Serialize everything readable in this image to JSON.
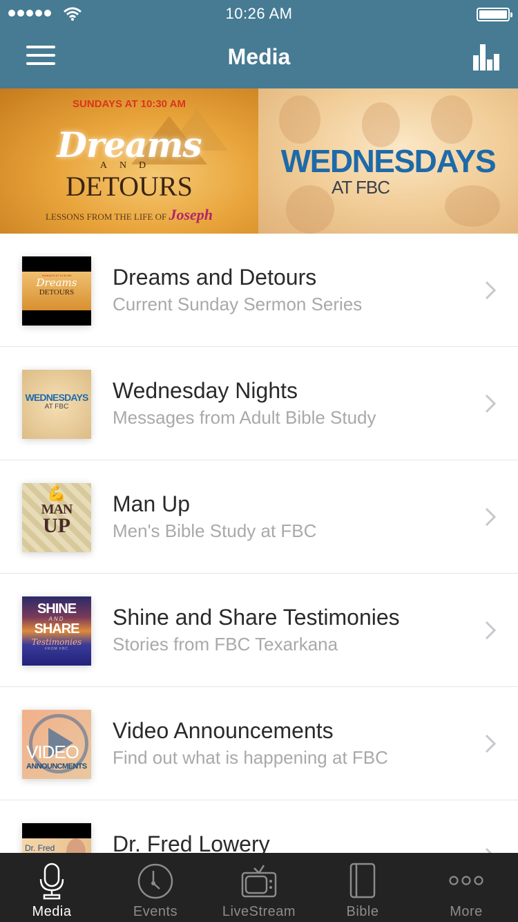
{
  "status_bar": {
    "time": "10:26 AM",
    "signal_bars": 5,
    "battery_percent": 100
  },
  "nav": {
    "title": "Media",
    "left_icon": "hamburger-menu-icon",
    "right_icon": "bar-chart-icon"
  },
  "banners": [
    {
      "name": "Dreams and Detours",
      "line1": "SUNDAYS AT 10:30 AM",
      "line2": "Dreams",
      "line3": "AND",
      "line4": "DETOURS",
      "line5": "LESSONS FROM THE LIFE OF",
      "line6": "Joseph"
    },
    {
      "name": "Wednesdays at FBC",
      "line1": "WEDNESDAYS",
      "line2": "AT FBC"
    }
  ],
  "list": {
    "items": [
      {
        "title": "Dreams and Detours",
        "subtitle": "Current Sunday Sermon Series",
        "thumb": {
          "t1": "SUNDAYS AT 10:30 AM",
          "t2": "Dreams",
          "t3": "DETOURS"
        }
      },
      {
        "title": "Wednesday Nights",
        "subtitle": "Messages from Adult Bible Study",
        "thumb": {
          "t1": "WEDNESDAYS",
          "t2": "AT FBC"
        }
      },
      {
        "title": "Man Up",
        "subtitle": "Men's Bible Study at FBC",
        "thumb": {
          "t0": "💪",
          "t1": "MAN",
          "t2": "UP"
        }
      },
      {
        "title": "Shine and Share Testimonies",
        "subtitle": "Stories from FBC Texarkana",
        "thumb": {
          "t1": "SHINE",
          "t2": "AND",
          "t3": "SHARE",
          "t4": "Testimonies",
          "t5": "FROM FBC"
        }
      },
      {
        "title": "Video Announcements",
        "subtitle": "Find out what is happening at FBC",
        "thumb": {
          "t1": "VIDEO",
          "t2": "ANNOUNCMENTS"
        }
      },
      {
        "title": "Dr. Fred Lowery",
        "subtitle": "",
        "thumb": {
          "t1": "Dr. Fred"
        }
      }
    ]
  },
  "tabbar": {
    "active": "Media",
    "tabs": [
      {
        "label": "Media",
        "icon": "microphone-icon"
      },
      {
        "label": "Events",
        "icon": "clock-icon"
      },
      {
        "label": "LiveStream",
        "icon": "tv-icon"
      },
      {
        "label": "Bible",
        "icon": "book-icon"
      },
      {
        "label": "More",
        "icon": "more-dots-icon"
      }
    ]
  },
  "colors": {
    "header_bg": "#467b93",
    "tabbar_bg": "#232323",
    "tab_active": "#ffffff",
    "tab_inactive": "#8c8c8c",
    "title_text": "#2a2a2a",
    "subtitle_text": "#a9a9a9"
  }
}
